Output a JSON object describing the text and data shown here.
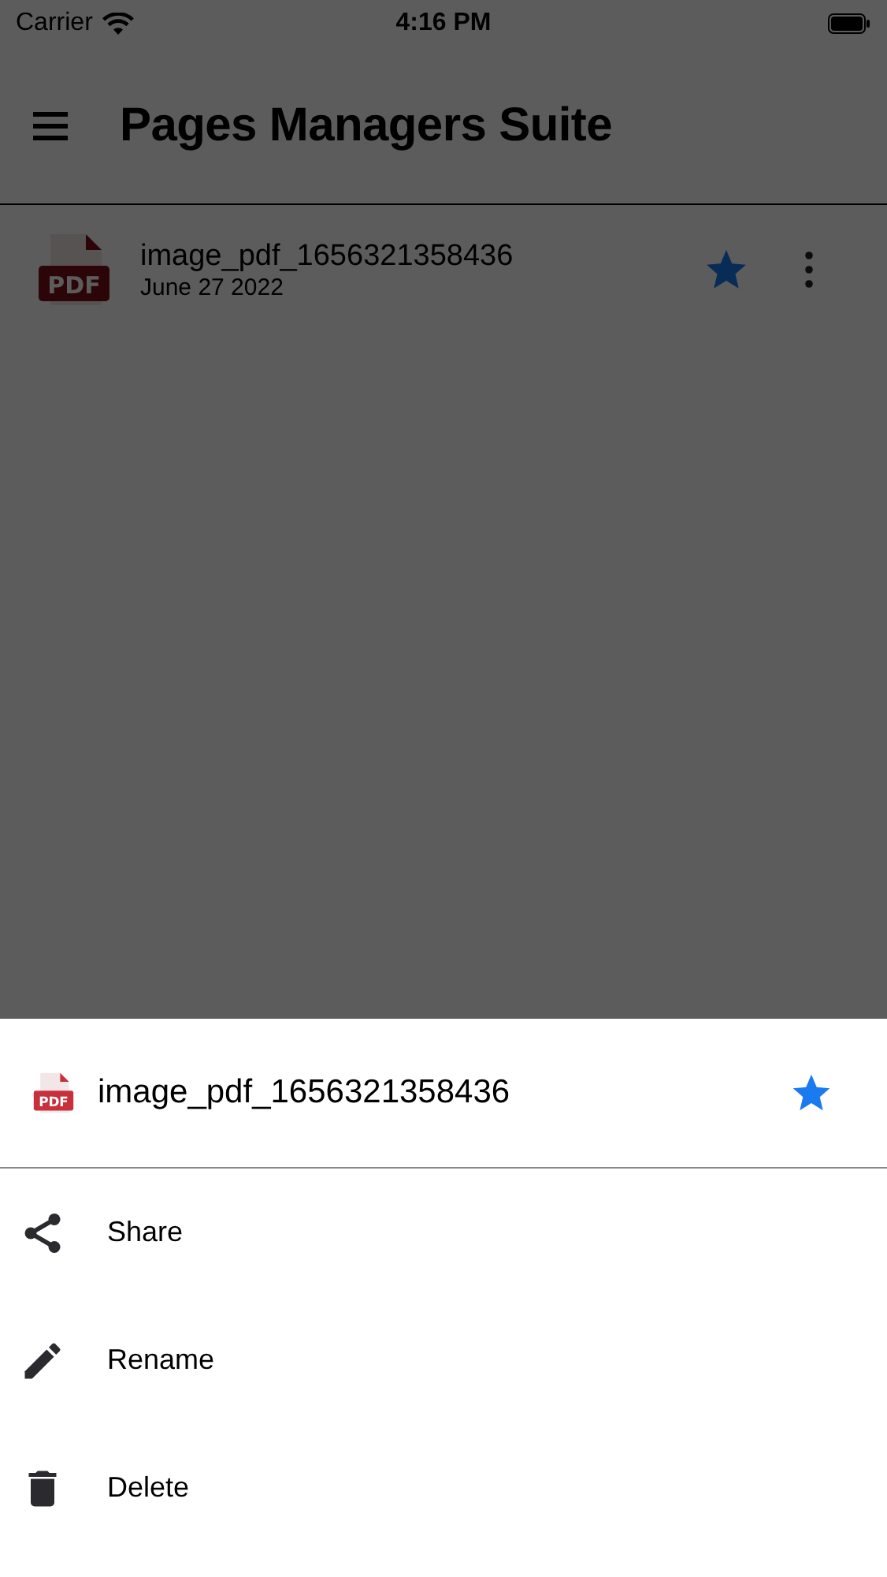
{
  "status_bar": {
    "carrier": "Carrier",
    "time": "4:16 PM"
  },
  "app_bar": {
    "title": "Pages Managers Suite"
  },
  "files": [
    {
      "name": "image_pdf_1656321358436",
      "date": "June 27 2022",
      "badge": "PDF",
      "starred": true
    }
  ],
  "sheet": {
    "file": {
      "name": "image_pdf_1656321358436",
      "badge": "PDF",
      "starred": true
    },
    "actions": [
      {
        "kind": "share",
        "label": "Share"
      },
      {
        "kind": "rename",
        "label": "Rename"
      },
      {
        "kind": "delete",
        "label": "Delete"
      }
    ]
  }
}
